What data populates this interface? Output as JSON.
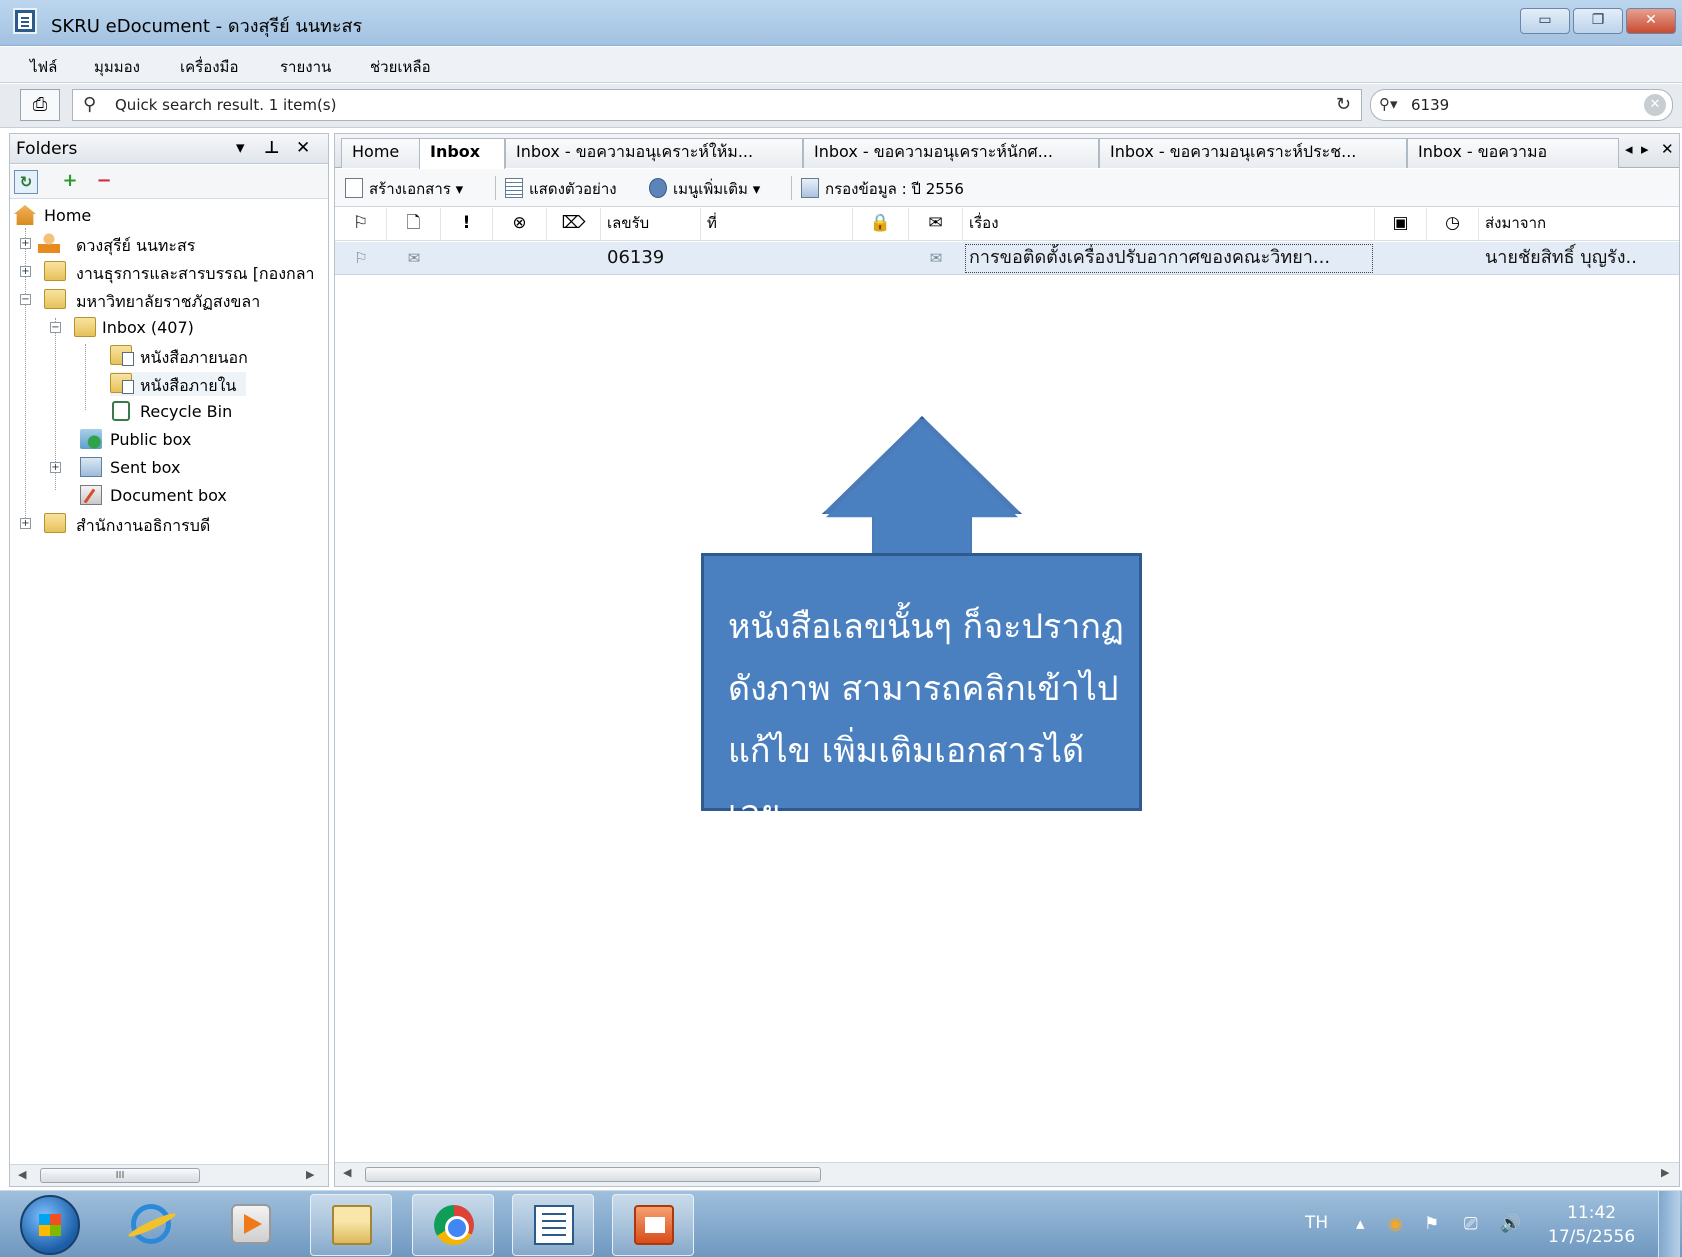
{
  "window": {
    "title": "SKRU eDocument - ดวงสุรีย์ นนทะสร",
    "min": "▭",
    "max": "❐",
    "close": "✕"
  },
  "menu": [
    "ไฟล์",
    "มุมมอง",
    "เครื่องมือ",
    "รายงาน",
    "ช่วยเหลือ"
  ],
  "search": {
    "quick_result": "Quick search result.  1 item(s)",
    "value": "6139",
    "clear": "✕"
  },
  "folders": {
    "title": "Folders",
    "tree": [
      {
        "label": "Home"
      },
      {
        "label": "ดวงสุรีย์ นนทะสร",
        "expander": "+"
      },
      {
        "label": "งานธุรการและสารบรรณ [กองกลา",
        "expander": "+"
      },
      {
        "label": "มหาวิทยาลัยราชภัฏสงขลา",
        "expander": "−"
      },
      {
        "label": "Inbox (407)",
        "expander": "−"
      },
      {
        "label": "หนังสือภายนอก"
      },
      {
        "label": "หนังสือภายใน"
      },
      {
        "label": "Recycle Bin"
      },
      {
        "label": "Public box"
      },
      {
        "label": "Sent box",
        "expander": "+"
      },
      {
        "label": "Document box"
      },
      {
        "label": "สำนักงานอธิการบดี",
        "expander": "+"
      }
    ],
    "scroll_grip": "III"
  },
  "tabs": [
    {
      "label": "Home"
    },
    {
      "label": "Inbox"
    },
    {
      "label": "Inbox - ขอความอนุเคราะห์ให้ม..."
    },
    {
      "label": "Inbox - ขอความอนุเคราะห์นักศ..."
    },
    {
      "label": "Inbox - ขอความอนุเคราะห์ประช..."
    },
    {
      "label": "Inbox - ขอความอ"
    }
  ],
  "commands": {
    "create": "สร้างเอกสาร ▾",
    "preview": "แสดงตัวอย่าง",
    "more": "เมนูเพิ่มเติม ▾",
    "filter": "กรองข้อมูล : ปี 2556"
  },
  "grid": {
    "headers": {
      "receive_no": "เลขรับ",
      "ref_no": "ที่",
      "subject": "เรื่อง",
      "from": "ส่งมาจาก"
    },
    "row": {
      "receive_no": "06139",
      "ref_no": "",
      "subject": "การขอติดตั้งเครื่องปรับอากาศของคณะวิทยา...",
      "from": "นายชัยสิทธิ์  บุญรัง.."
    }
  },
  "callout": {
    "text": "หนังสือเลขนั้นๆ ก็จะปรากฏดังภาพ สามารถคลิกเข้าไปแก้ไข เพิ่มเติมเอกสารได้เลย",
    "color": "#4a80c0"
  },
  "taskbar": {
    "lang": "TH",
    "time": "11:42",
    "date": "17/5/2556"
  }
}
